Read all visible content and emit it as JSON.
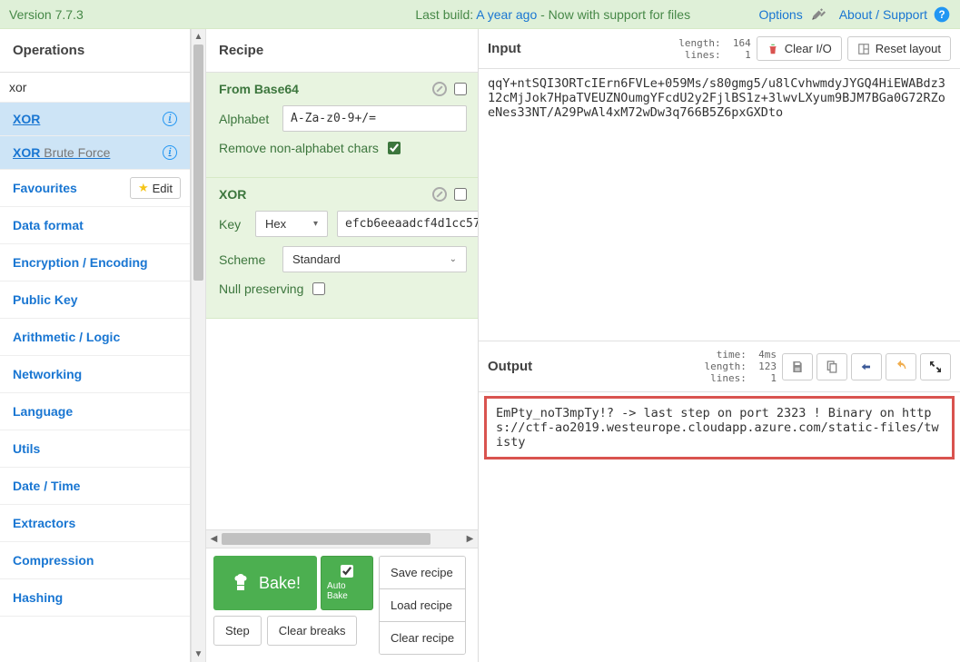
{
  "banner": {
    "version": "Version 7.7.3",
    "build_prefix": "Last build: ",
    "build_link": "A year ago",
    "build_suffix": " - Now with support for files",
    "options": "Options",
    "about": "About / Support"
  },
  "operations": {
    "title": "Operations",
    "search_value": "xor",
    "results": [
      {
        "label": "XOR",
        "selected": true
      },
      {
        "label": "XOR",
        "tail": " Brute Force",
        "selected": false
      }
    ],
    "favourites_label": "Favourites",
    "edit_label": "Edit",
    "categories": [
      "Data format",
      "Encryption / Encoding",
      "Public Key",
      "Arithmetic / Logic",
      "Networking",
      "Language",
      "Utils",
      "Date / Time",
      "Extractors",
      "Compression",
      "Hashing"
    ]
  },
  "recipe": {
    "title": "Recipe",
    "ops": [
      {
        "name": "From Base64",
        "args": {
          "alphabet_label": "Alphabet",
          "alphabet_value": "A-Za-z0-9+/=",
          "remove_label": "Remove non-alphabet chars",
          "remove_checked": true
        }
      },
      {
        "name": "XOR",
        "args": {
          "key_label": "Key",
          "key_type": "Hex",
          "key_value": "efcb6eeaadcf4d1cc57",
          "scheme_label": "Scheme",
          "scheme_value": "Standard",
          "null_label": "Null preserving",
          "null_checked": false
        }
      }
    ],
    "bake": "Bake!",
    "auto_bake": "Auto Bake",
    "step": "Step",
    "clear_breaks": "Clear breaks",
    "save_recipe": "Save recipe",
    "load_recipe": "Load recipe",
    "clear_recipe": "Clear recipe"
  },
  "input": {
    "title": "Input",
    "stats": "length:  164\n lines:    1",
    "clear_io": "Clear I/O",
    "reset_layout": "Reset layout",
    "value": "qqY+ntSQI3ORTcIErn6FVLe+059Ms/s80gmg5/u8lCvhwmdyJYGQ4HiEWABdz312cMjJok7HpaTVEUZNOumgYFcdU2y2FjlBS1z+3lwvLXyum9BJM7BGa0G72RZoeNes33NT/A29PwAl4xM72wDw3q766B5Z6pxGXDto"
  },
  "output": {
    "title": "Output",
    "stats": "  time:  4ms\nlength:  123\n lines:    1",
    "value": "EmPty_noT3mpTy!? -> last step on port 2323 ! Binary on https://ctf-ao2019.westeurope.cloudapp.azure.com/static-files/twisty"
  }
}
